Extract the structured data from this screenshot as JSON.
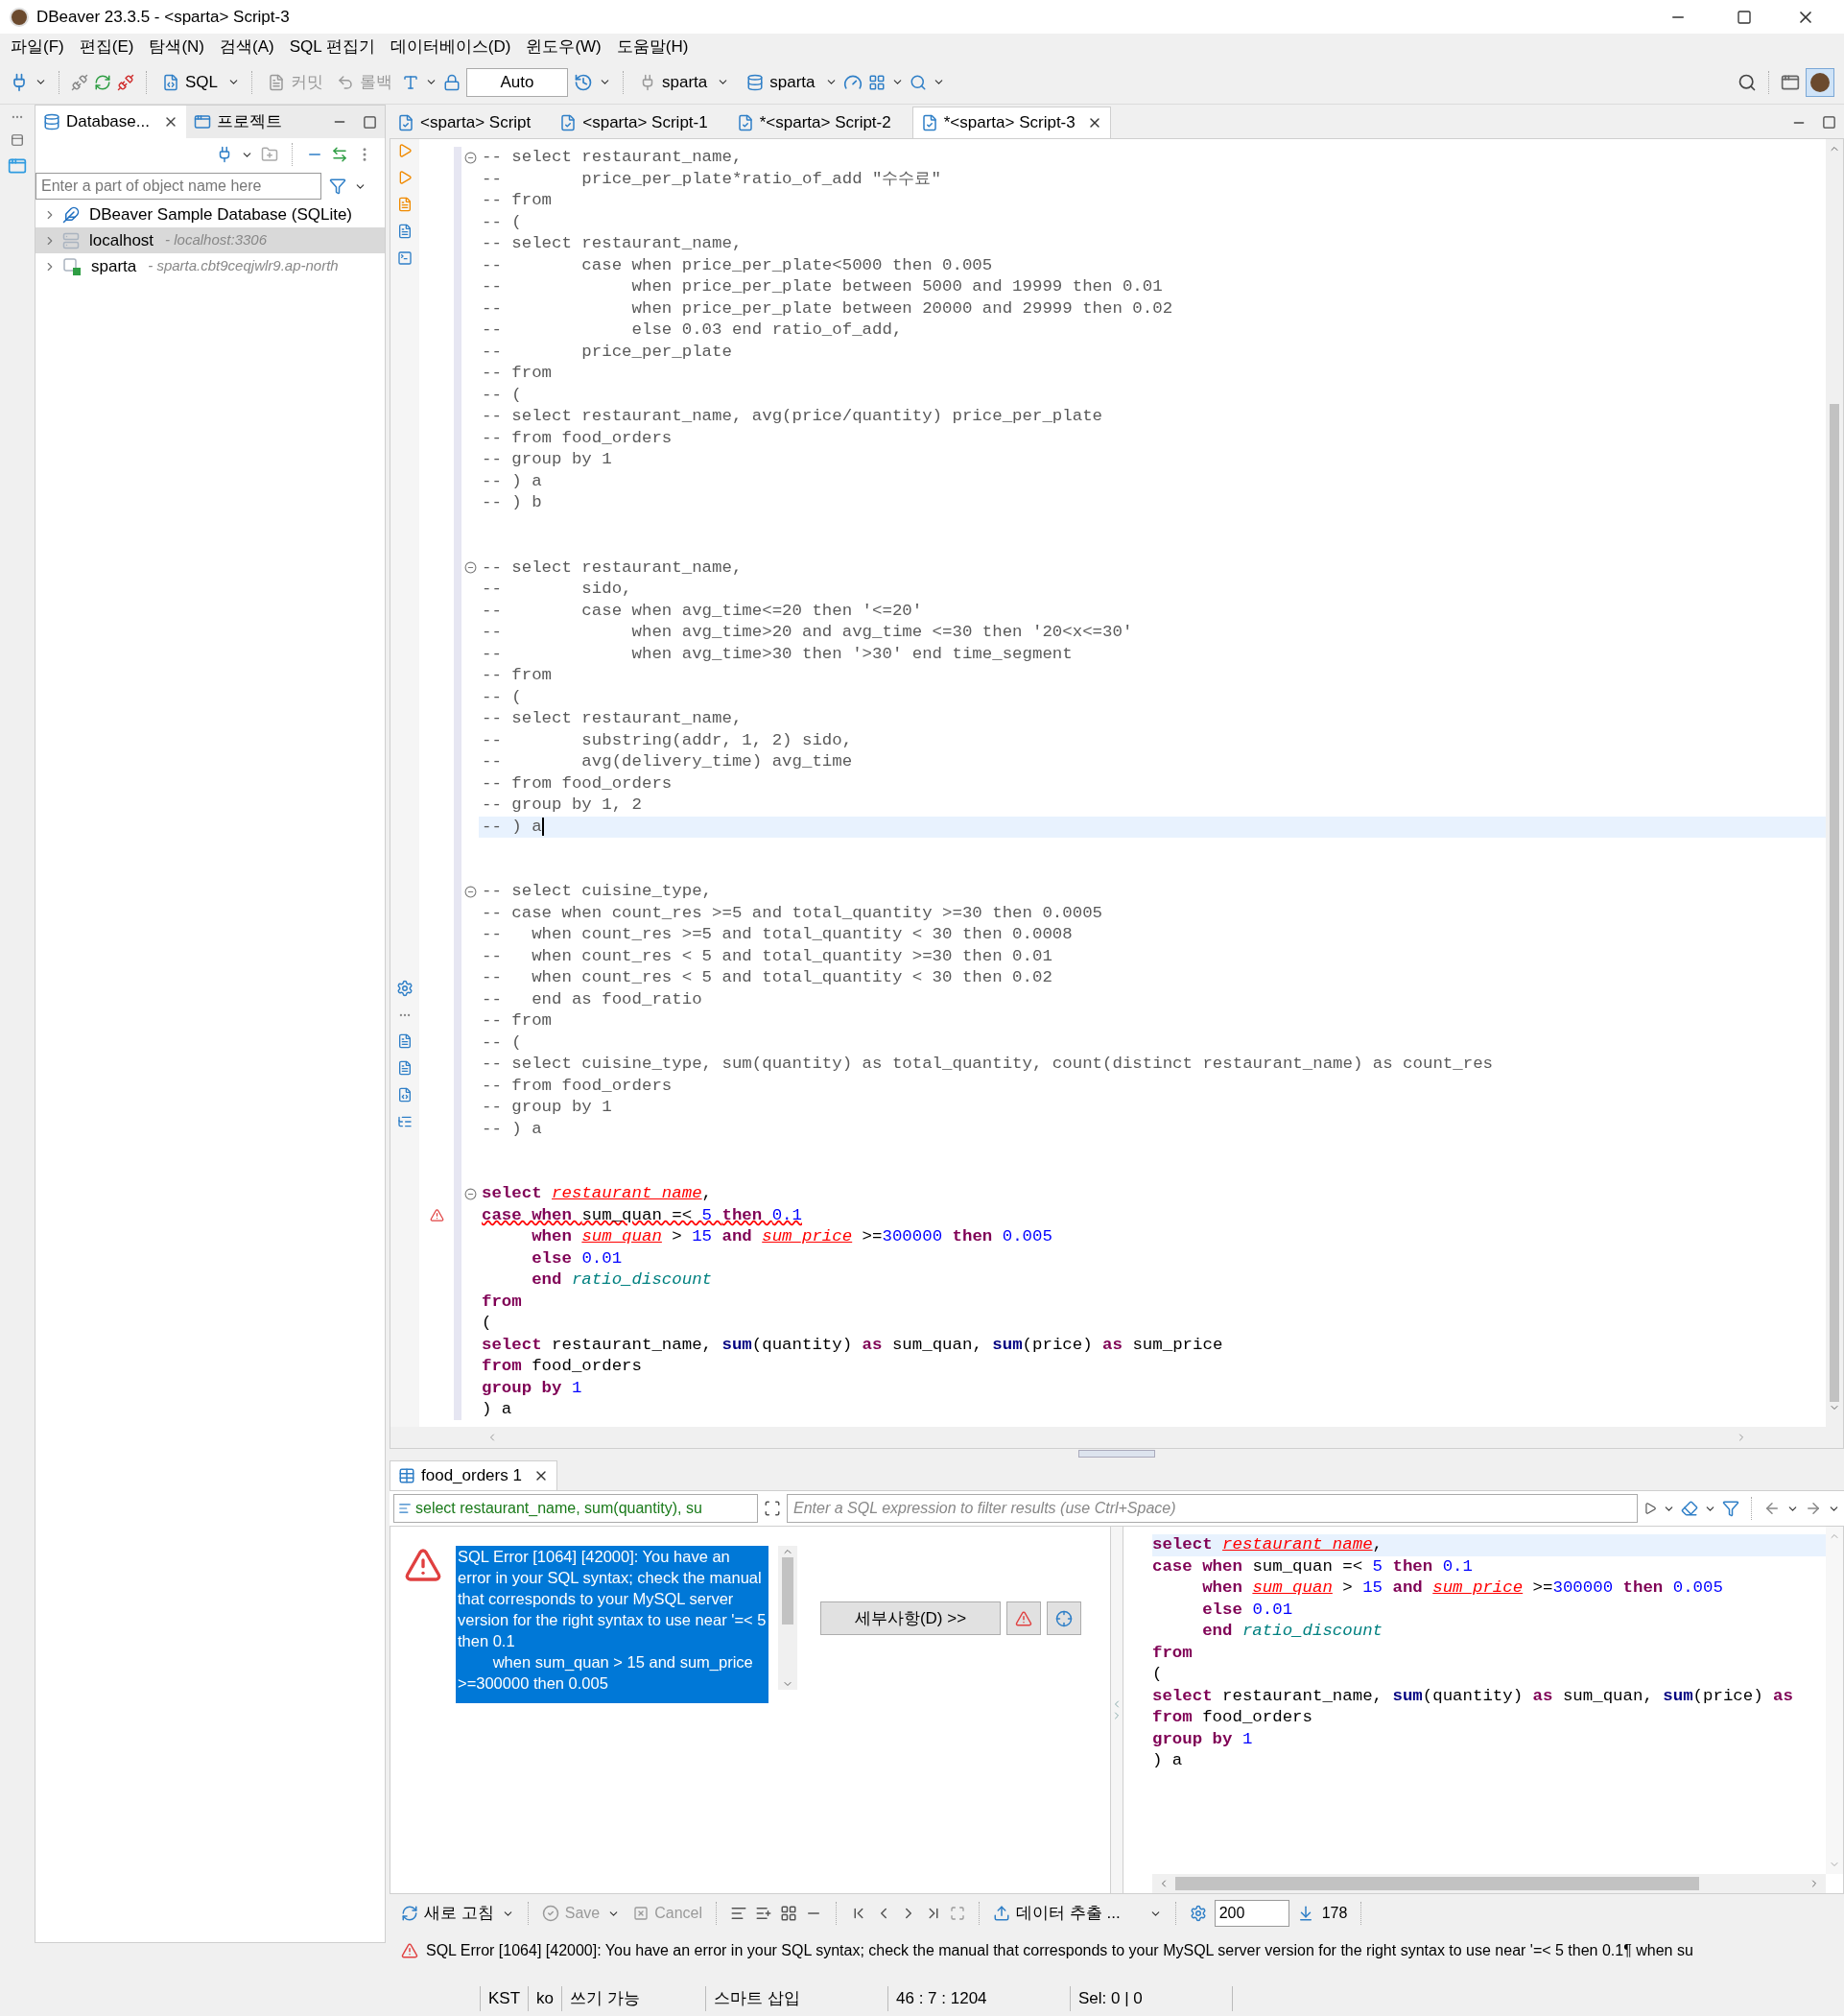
{
  "window": {
    "title": "DBeaver 23.3.5 - <sparta> Script-3"
  },
  "menu": [
    "파일(F)",
    "편집(E)",
    "탐색(N)",
    "검색(A)",
    "SQL 편집기",
    "데이터베이스(D)",
    "윈도우(W)",
    "도움말(H)"
  ],
  "toolbar": {
    "sql": "SQL",
    "commit": {
      "label": "커밋",
      "disabled": true
    },
    "rollback": {
      "label": "롤백",
      "disabled": true
    },
    "transaction_mode": "Auto",
    "datasource": "sparta",
    "schema": "sparta"
  },
  "left_panel": {
    "tabs": [
      {
        "label": "Database...",
        "selected": true
      },
      {
        "label": "프로젝트",
        "selected": false
      }
    ],
    "filter": {
      "placeholder": "Enter a part of object name here"
    },
    "tree": [
      {
        "label": "DBeaver Sample Database (SQLite)",
        "kind": "sqlite",
        "selected": false
      },
      {
        "label": "localhost",
        "detail": "- localhost:3306",
        "kind": "mysql",
        "selected": true
      },
      {
        "label": "sparta",
        "detail": "- sparta.cbt9ceqjwlr9.ap-north",
        "kind": "mysql-connected",
        "selected": false
      }
    ]
  },
  "editor": {
    "tabs": [
      {
        "label": "<sparta> Script",
        "selected": false
      },
      {
        "label": "<sparta> Script-1",
        "selected": false
      },
      {
        "label": "*<sparta> Script-2",
        "selected": false
      },
      {
        "label": "*<sparta> Script-3",
        "selected": true
      }
    ],
    "lines": [
      {
        "kind": "fold",
        "tokens": [
          {
            "text": "-- select restaurant_name,",
            "kind": "comment"
          }
        ]
      },
      {
        "kind": "plain",
        "tokens": [
          {
            "text": "--        price_per_plate*ratio_of_add \"수수료\"",
            "kind": "comment"
          }
        ]
      },
      {
        "kind": "plain",
        "tokens": [
          {
            "text": "-- from",
            "kind": "comment"
          }
        ]
      },
      {
        "kind": "plain",
        "tokens": [
          {
            "text": "-- (",
            "kind": "comment"
          }
        ]
      },
      {
        "kind": "plain",
        "tokens": [
          {
            "text": "-- select restaurant_name,",
            "kind": "comment"
          }
        ]
      },
      {
        "kind": "plain",
        "tokens": [
          {
            "text": "--        case when price_per_plate<5000 then 0.005",
            "kind": "comment"
          }
        ]
      },
      {
        "kind": "plain",
        "tokens": [
          {
            "text": "--             when price_per_plate between 5000 and 19999 then 0.01",
            "kind": "comment"
          }
        ]
      },
      {
        "kind": "plain",
        "tokens": [
          {
            "text": "--             when price_per_plate between 20000 and 29999 then 0.02",
            "kind": "comment"
          }
        ]
      },
      {
        "kind": "plain",
        "tokens": [
          {
            "text": "--             else 0.03 end ratio_of_add,",
            "kind": "comment"
          }
        ]
      },
      {
        "kind": "plain",
        "tokens": [
          {
            "text": "--        price_per_plate",
            "kind": "comment"
          }
        ]
      },
      {
        "kind": "plain",
        "tokens": [
          {
            "text": "-- from",
            "kind": "comment"
          }
        ]
      },
      {
        "kind": "plain",
        "tokens": [
          {
            "text": "-- (",
            "kind": "comment"
          }
        ]
      },
      {
        "kind": "plain",
        "tokens": [
          {
            "text": "-- select restaurant_name, avg(price/quantity) price_per_plate",
            "kind": "comment"
          }
        ]
      },
      {
        "kind": "plain",
        "tokens": [
          {
            "text": "-- from food_orders",
            "kind": "comment"
          }
        ]
      },
      {
        "kind": "plain",
        "tokens": [
          {
            "text": "-- group by 1",
            "kind": "comment"
          }
        ]
      },
      {
        "kind": "plain",
        "tokens": [
          {
            "text": "-- ) a",
            "kind": "comment"
          }
        ]
      },
      {
        "kind": "plain",
        "tokens": [
          {
            "text": "-- ) b",
            "kind": "comment"
          }
        ]
      },
      {
        "kind": "blank"
      },
      {
        "kind": "blank"
      },
      {
        "kind": "fold",
        "tokens": [
          {
            "text": "-- select restaurant_name,",
            "kind": "comment"
          }
        ]
      },
      {
        "kind": "plain",
        "tokens": [
          {
            "text": "--        sido,",
            "kind": "comment"
          }
        ]
      },
      {
        "kind": "plain",
        "tokens": [
          {
            "text": "--        case when avg_time<=20 then '<=20'",
            "kind": "comment"
          }
        ]
      },
      {
        "kind": "plain",
        "tokens": [
          {
            "text": "--             when avg_time>20 and avg_time <=30 then '20<x<=30'",
            "kind": "comment"
          }
        ]
      },
      {
        "kind": "plain",
        "tokens": [
          {
            "text": "--             when avg_time>30 then '>30' end time_segment",
            "kind": "comment"
          }
        ]
      },
      {
        "kind": "plain",
        "tokens": [
          {
            "text": "-- from",
            "kind": "comment"
          }
        ]
      },
      {
        "kind": "plain",
        "tokens": [
          {
            "text": "-- (",
            "kind": "comment"
          }
        ]
      },
      {
        "kind": "plain",
        "tokens": [
          {
            "text": "-- select restaurant_name,",
            "kind": "comment"
          }
        ]
      },
      {
        "kind": "plain",
        "tokens": [
          {
            "text": "--        substring(addr, 1, 2) sido,",
            "kind": "comment"
          }
        ]
      },
      {
        "kind": "plain",
        "tokens": [
          {
            "text": "--        avg(delivery_time) avg_time",
            "kind": "comment"
          }
        ]
      },
      {
        "kind": "plain",
        "tokens": [
          {
            "text": "-- from food_orders",
            "kind": "comment"
          }
        ]
      },
      {
        "kind": "plain",
        "tokens": [
          {
            "text": "-- group by 1, 2",
            "kind": "comment"
          }
        ]
      },
      {
        "kind": "current",
        "tokens": [
          {
            "text": "-- ) a",
            "kind": "comment"
          }
        ]
      },
      {
        "kind": "blank"
      },
      {
        "kind": "blank"
      },
      {
        "kind": "fold",
        "tokens": [
          {
            "text": "-- select cuisine_type,",
            "kind": "comment"
          }
        ]
      },
      {
        "kind": "plain",
        "tokens": [
          {
            "text": "-- case when count_res >=5 and total_quantity >=30 then 0.0005",
            "kind": "comment"
          }
        ]
      },
      {
        "kind": "plain",
        "tokens": [
          {
            "text": "--   when count_res >=5 and total_quantity < 30 then 0.0008",
            "kind": "comment"
          }
        ]
      },
      {
        "kind": "plain",
        "tokens": [
          {
            "text": "--   when count_res < 5 and total_quantity >=30 then 0.01",
            "kind": "comment"
          }
        ]
      },
      {
        "kind": "plain",
        "tokens": [
          {
            "text": "--   when count_res < 5 and total_quantity < 30 then 0.02",
            "kind": "comment"
          }
        ]
      },
      {
        "kind": "plain",
        "tokens": [
          {
            "text": "--   end as food_ratio",
            "kind": "comment"
          }
        ]
      },
      {
        "kind": "plain",
        "tokens": [
          {
            "text": "-- from",
            "kind": "comment"
          }
        ]
      },
      {
        "kind": "plain",
        "tokens": [
          {
            "text": "-- (",
            "kind": "comment"
          }
        ]
      },
      {
        "kind": "plain",
        "tokens": [
          {
            "text": "-- select cuisine_type, sum(quantity) as total_quantity, count(distinct restaurant_name) as count_res",
            "kind": "comment"
          }
        ]
      },
      {
        "kind": "plain",
        "tokens": [
          {
            "text": "-- from food_orders",
            "kind": "comment"
          }
        ]
      },
      {
        "kind": "plain",
        "tokens": [
          {
            "text": "-- group by 1",
            "kind": "comment"
          }
        ]
      },
      {
        "kind": "plain",
        "tokens": [
          {
            "text": "-- ) a",
            "kind": "comment"
          }
        ]
      },
      {
        "kind": "blank"
      },
      {
        "kind": "blank"
      },
      {
        "kind": "fold",
        "tokens": [
          {
            "text": "select ",
            "kind": "keyword"
          },
          {
            "text": "restaurant_name",
            "kind": "column_error"
          },
          {
            "text": ",",
            "kind": "plain"
          }
        ]
      },
      {
        "kind": "error",
        "tokens": [
          {
            "text": "case when ",
            "kind": "keyword"
          },
          {
            "text": "sum_quan =< ",
            "kind": "plain"
          },
          {
            "text": "5 ",
            "kind": "number"
          },
          {
            "text": "then ",
            "kind": "keyword"
          },
          {
            "text": "0.1",
            "kind": "number"
          }
        ]
      },
      {
        "kind": "plain",
        "tokens": [
          {
            "text": "     when ",
            "kind": "keyword"
          },
          {
            "text": "sum_quan",
            "kind": "column_error"
          },
          {
            "text": " > ",
            "kind": "plain"
          },
          {
            "text": "15 ",
            "kind": "number"
          },
          {
            "text": "and ",
            "kind": "keyword"
          },
          {
            "text": "sum_price",
            "kind": "column_error"
          },
          {
            "text": " >=",
            "kind": "plain"
          },
          {
            "text": "300000 ",
            "kind": "number"
          },
          {
            "text": "then ",
            "kind": "keyword"
          },
          {
            "text": "0.005",
            "kind": "number"
          }
        ]
      },
      {
        "kind": "plain",
        "tokens": [
          {
            "text": "     else ",
            "kind": "keyword"
          },
          {
            "text": "0.01",
            "kind": "number"
          }
        ]
      },
      {
        "kind": "plain",
        "tokens": [
          {
            "text": "     end ",
            "kind": "keyword"
          },
          {
            "text": "ratio_discount",
            "kind": "alias"
          }
        ]
      },
      {
        "kind": "plain",
        "tokens": [
          {
            "text": "from",
            "kind": "keyword"
          }
        ]
      },
      {
        "kind": "plain",
        "tokens": [
          {
            "text": "(",
            "kind": "plain"
          }
        ]
      },
      {
        "kind": "plain",
        "tokens": [
          {
            "text": "select",
            "kind": "keyword"
          },
          {
            "text": " restaurant_name, ",
            "kind": "plain"
          },
          {
            "text": "sum",
            "kind": "function"
          },
          {
            "text": "(quantity) ",
            "kind": "plain"
          },
          {
            "text": "as",
            "kind": "keyword"
          },
          {
            "text": " sum_quan, ",
            "kind": "plain"
          },
          {
            "text": "sum",
            "kind": "function"
          },
          {
            "text": "(price) ",
            "kind": "plain"
          },
          {
            "text": "as",
            "kind": "keyword"
          },
          {
            "text": " sum_price",
            "kind": "plain"
          }
        ]
      },
      {
        "kind": "plain",
        "tokens": [
          {
            "text": "from",
            "kind": "keyword"
          },
          {
            "text": " food_orders",
            "kind": "plain"
          }
        ]
      },
      {
        "kind": "plain",
        "tokens": [
          {
            "text": "group by ",
            "kind": "keyword"
          },
          {
            "text": "1",
            "kind": "number"
          }
        ]
      },
      {
        "kind": "plain",
        "tokens": [
          {
            "text": ") a",
            "kind": "plain"
          }
        ]
      }
    ]
  },
  "results": {
    "tab": "food_orders 1",
    "query": "select restaurant_name, sum(quantity), su",
    "filter": {
      "placeholder": "Enter a SQL expression to filter results (use Ctrl+Space)"
    },
    "error": {
      "message": "SQL Error [1064] [42000]: You have an error in your SQL syntax; check the manual that corresponds to your MySQL server version for the right syntax to use near '=< 5 then 0.1\n        when sum_quan > 15 and sum_price >=300000 then 0.005",
      "details_button": "세부사항(D) >>"
    },
    "preview_lines": [
      {
        "kind": "current",
        "tokens": [
          {
            "text": "select ",
            "kind": "keyword"
          },
          {
            "text": "restaurant_name",
            "kind": "column_error"
          },
          {
            "text": ",",
            "kind": "plain"
          }
        ]
      },
      {
        "kind": "plain",
        "tokens": [
          {
            "text": "case when ",
            "kind": "keyword"
          },
          {
            "text": "sum_quan =< ",
            "kind": "plain"
          },
          {
            "text": "5 ",
            "kind": "number"
          },
          {
            "text": "then ",
            "kind": "keyword"
          },
          {
            "text": "0.1",
            "kind": "number"
          }
        ]
      },
      {
        "kind": "plain",
        "tokens": [
          {
            "text": "     when ",
            "kind": "keyword"
          },
          {
            "text": "sum_quan",
            "kind": "column_error"
          },
          {
            "text": " > ",
            "kind": "plain"
          },
          {
            "text": "15 ",
            "kind": "number"
          },
          {
            "text": "and ",
            "kind": "keyword"
          },
          {
            "text": "sum_price",
            "kind": "column_error"
          },
          {
            "text": " >=",
            "kind": "plain"
          },
          {
            "text": "300000 ",
            "kind": "number"
          },
          {
            "text": "then ",
            "kind": "keyword"
          },
          {
            "text": "0.005",
            "kind": "number"
          }
        ]
      },
      {
        "kind": "plain",
        "tokens": [
          {
            "text": "     else ",
            "kind": "keyword"
          },
          {
            "text": "0.01",
            "kind": "number"
          }
        ]
      },
      {
        "kind": "plain",
        "tokens": [
          {
            "text": "     end ",
            "kind": "keyword"
          },
          {
            "text": "ratio_discount",
            "kind": "alias"
          }
        ]
      },
      {
        "kind": "plain",
        "tokens": [
          {
            "text": "from",
            "kind": "keyword"
          }
        ]
      },
      {
        "kind": "plain",
        "tokens": [
          {
            "text": "(",
            "kind": "plain"
          }
        ]
      },
      {
        "kind": "plain",
        "tokens": [
          {
            "text": "select",
            "kind": "keyword"
          },
          {
            "text": " restaurant_name, ",
            "kind": "plain"
          },
          {
            "text": "sum",
            "kind": "function"
          },
          {
            "text": "(quantity) ",
            "kind": "plain"
          },
          {
            "text": "as",
            "kind": "keyword"
          },
          {
            "text": " sum_quan, ",
            "kind": "plain"
          },
          {
            "text": "sum",
            "kind": "function"
          },
          {
            "text": "(price) ",
            "kind": "plain"
          },
          {
            "text": "as",
            "kind": "keyword"
          }
        ]
      },
      {
        "kind": "plain",
        "tokens": [
          {
            "text": "from",
            "kind": "keyword"
          },
          {
            "text": " food_orders",
            "kind": "plain"
          }
        ]
      },
      {
        "kind": "plain",
        "tokens": [
          {
            "text": "group by ",
            "kind": "keyword"
          },
          {
            "text": "1",
            "kind": "number"
          }
        ]
      },
      {
        "kind": "plain",
        "tokens": [
          {
            "text": ") a",
            "kind": "plain"
          }
        ]
      }
    ],
    "toolbar": {
      "refresh": "새로 고침",
      "save": {
        "label": "Save",
        "disabled": true
      },
      "cancel": {
        "label": "Cancel",
        "disabled": true
      },
      "export": "데이터 추출 ...",
      "fetch_size": "200",
      "row_count": "178"
    }
  },
  "status": {
    "message": "SQL Error [1064] [42000]: You have an error in your SQL syntax; check the manual that corresponds to your MySQL server version for the right syntax to use near '=< 5 then 0.1¶  when su",
    "fields": [
      "KST",
      "ko",
      "쓰기 가능",
      "스마트 삽입",
      "46 : 7 : 1204",
      "Sel: 0 | 0"
    ]
  }
}
